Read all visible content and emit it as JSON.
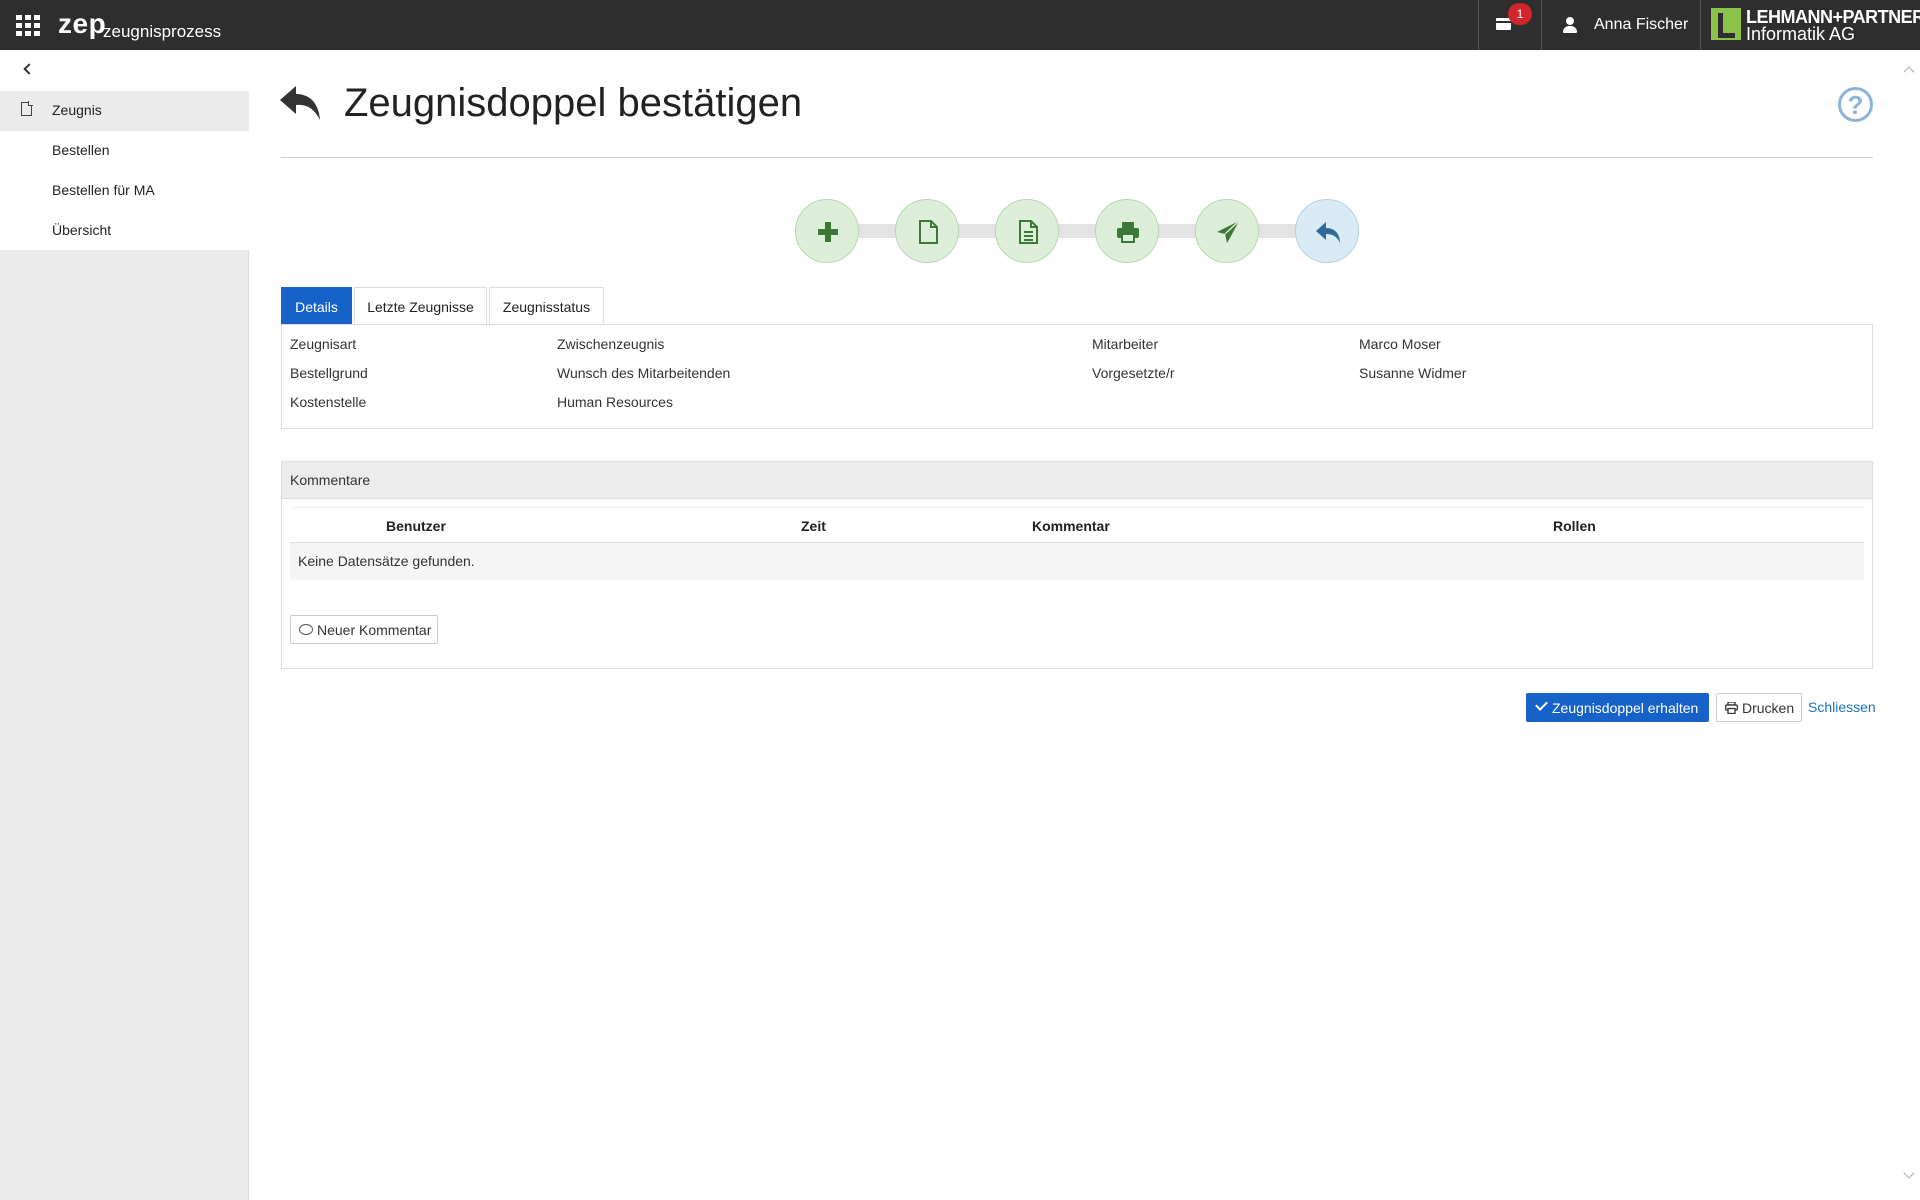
{
  "header": {
    "brand": "zep",
    "brand_sub": "zeugnisprozess",
    "notification_count": "1",
    "user_name": "Anna Fischer",
    "logo_line1": "LEHMANN+PARTNER",
    "logo_line2": "Informatik AG"
  },
  "sidebar": {
    "section_label": "Zeugnis",
    "items": [
      {
        "label": "Bestellen"
      },
      {
        "label": "Bestellen für MA"
      },
      {
        "label": "Übersicht"
      }
    ]
  },
  "main": {
    "title": "Zeugnisdoppel bestätigen",
    "steps": [
      {
        "icon": "plus-icon",
        "color": "#3a7a36"
      },
      {
        "icon": "file-icon",
        "color": "#3a7a36"
      },
      {
        "icon": "file-text-icon",
        "color": "#3a7a36"
      },
      {
        "icon": "print-icon",
        "color": "#3a7a36"
      },
      {
        "icon": "send-icon",
        "color": "#3a7a36"
      },
      {
        "icon": "reply-icon",
        "color": "#2f6b96"
      }
    ],
    "tabs": [
      {
        "label": "Details",
        "active": true
      },
      {
        "label": "Letzte Zeugnisse",
        "active": false
      },
      {
        "label": "Zeugnisstatus",
        "active": false
      }
    ],
    "details": {
      "zeugnisart_label": "Zeugnisart",
      "zeugnisart_value": "Zwischenzeugnis",
      "bestellgrund_label": "Bestellgrund",
      "bestellgrund_value": "Wunsch des Mitarbeitenden",
      "kostenstelle_label": "Kostenstelle",
      "kostenstelle_value": "Human Resources",
      "mitarbeiter_label": "Mitarbeiter",
      "mitarbeiter_value": "Marco Moser",
      "vorgesetzte_label": "Vorgesetzte/r",
      "vorgesetzte_value": "Susanne Widmer"
    },
    "comments": {
      "title": "Kommentare",
      "columns": [
        "Benutzer",
        "Zeit",
        "Kommentar",
        "Rollen"
      ],
      "empty_text": "Keine Datensätze gefunden.",
      "new_button": "Neuer Kommentar"
    },
    "actions": {
      "confirm": "Zeugnisdoppel erhalten",
      "print": "Drucken",
      "close": "Schliessen"
    }
  },
  "colors": {
    "topbar": "#2e2e2e",
    "accent": "#1662c9",
    "badge": "#d0262b",
    "step_green": "#ddefd9",
    "step_blue": "#d9ebf5"
  }
}
